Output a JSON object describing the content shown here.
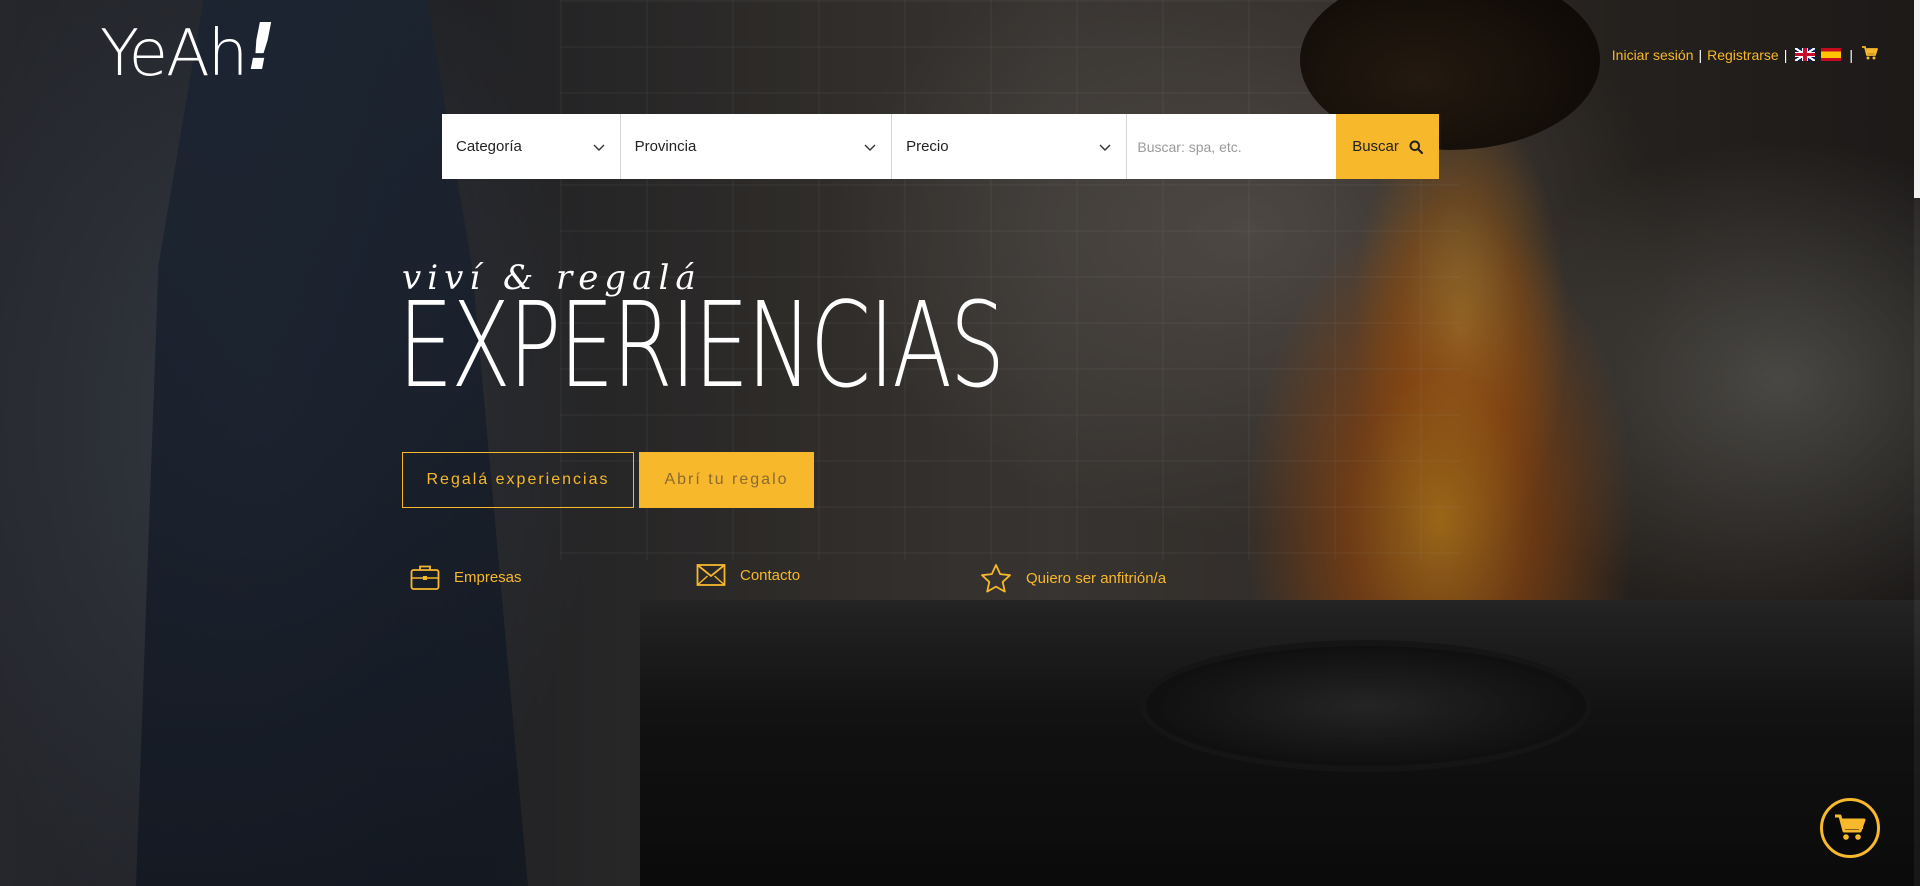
{
  "brand": {
    "logo_text": "YeAh",
    "logo_bang": "!"
  },
  "topnav": {
    "login": "Iniciar sesión",
    "separator": "|",
    "register": "Registrarse",
    "languages": [
      "en-flag-icon",
      "es-flag-icon"
    ],
    "cart_icon": "cart-icon"
  },
  "search": {
    "category_label": "Categoría",
    "province_label": "Provincia",
    "price_label": "Precio",
    "placeholder": "Buscar: spa, etc.",
    "button_label": "Buscar"
  },
  "hero": {
    "tagline": "viví & regalá",
    "headline": "EXPERIENCIAS",
    "cta_gift": "Regalá experiencias",
    "cta_open": "Abrí tu regalo"
  },
  "links": {
    "empresas": "Empresas",
    "contacto": "Contacto",
    "anfitrion": "Quiero ser anfitrión/a"
  },
  "colors": {
    "accent": "#f7b82c",
    "text_light": "#ffffff"
  }
}
